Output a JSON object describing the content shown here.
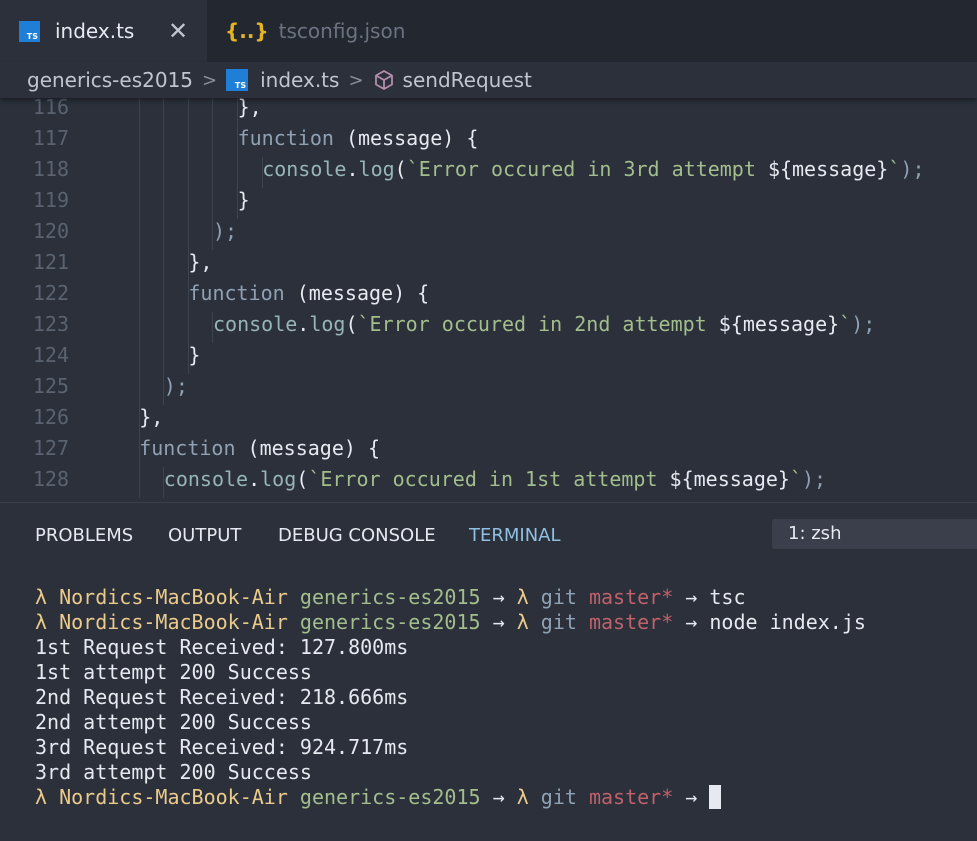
{
  "tabs": [
    {
      "label": "index.ts",
      "icon": "typescript-icon",
      "active": true
    },
    {
      "label": "tsconfig.json",
      "icon": "json-icon",
      "active": false
    }
  ],
  "tab_icon_text": {
    "ts": "TS",
    "json": "{..}",
    "close": "✕"
  },
  "breadcrumb": {
    "folder": "generics-es2015",
    "file": "index.ts",
    "symbol": "sendRequest",
    "separator": ">"
  },
  "editor": {
    "lines": [
      {
        "n": "116",
        "indent": 6,
        "code": "},"
      },
      {
        "n": "117",
        "indent": 6,
        "code": "function (message) {"
      },
      {
        "n": "118",
        "indent": 7,
        "code": "console.log(`Error occured in 3rd attempt ${message}`);"
      },
      {
        "n": "119",
        "indent": 6,
        "code": "}"
      },
      {
        "n": "120",
        "indent": 5,
        "code": ");"
      },
      {
        "n": "121",
        "indent": 4,
        "code": "},"
      },
      {
        "n": "122",
        "indent": 4,
        "code": "function (message) {"
      },
      {
        "n": "123",
        "indent": 5,
        "code": "console.log(`Error occured in 2nd attempt ${message}`);"
      },
      {
        "n": "124",
        "indent": 4,
        "code": "}"
      },
      {
        "n": "125",
        "indent": 3,
        "code": ");"
      },
      {
        "n": "126",
        "indent": 2,
        "code": "},"
      },
      {
        "n": "127",
        "indent": 2,
        "code": "function (message) {"
      },
      {
        "n": "128",
        "indent": 3,
        "code": "console.log(`Error occured in 1st attempt ${message}`);"
      }
    ]
  },
  "panel": {
    "tabs": [
      "PROBLEMS",
      "OUTPUT",
      "DEBUG CONSOLE",
      "TERMINAL"
    ],
    "active_tab": "TERMINAL",
    "terminal_select": "1: zsh"
  },
  "terminal": {
    "prompt": {
      "lambda": "λ",
      "host": "Nordics-MacBook-Air",
      "dir": "generics-es2015",
      "arrow": "→",
      "git": "git",
      "branch": "master*"
    },
    "lines": [
      {
        "type": "prompt",
        "cmd": "tsc"
      },
      {
        "type": "prompt",
        "cmd": "node index.js"
      },
      {
        "type": "out",
        "text": "1st Request Received: 127.800ms"
      },
      {
        "type": "out",
        "text": "1st attempt 200 Success"
      },
      {
        "type": "out",
        "text": "2nd Request Received: 218.666ms"
      },
      {
        "type": "out",
        "text": "2nd attempt 200 Success"
      },
      {
        "type": "out",
        "text": "3rd Request Received: 924.717ms"
      },
      {
        "type": "out",
        "text": "3rd attempt 200 Success"
      },
      {
        "type": "prompt",
        "cmd": "",
        "cursor": true
      }
    ]
  },
  "colors": {
    "background": "#2b303b",
    "tab_bar": "#232730",
    "keyword": "#8fa1b3",
    "function": "#96b5b4",
    "string": "#a3be8c",
    "host": "#ebcb8b",
    "branch": "#bf616a",
    "ts_icon": "#1f7fd6",
    "json_icon": "#e6b422"
  }
}
